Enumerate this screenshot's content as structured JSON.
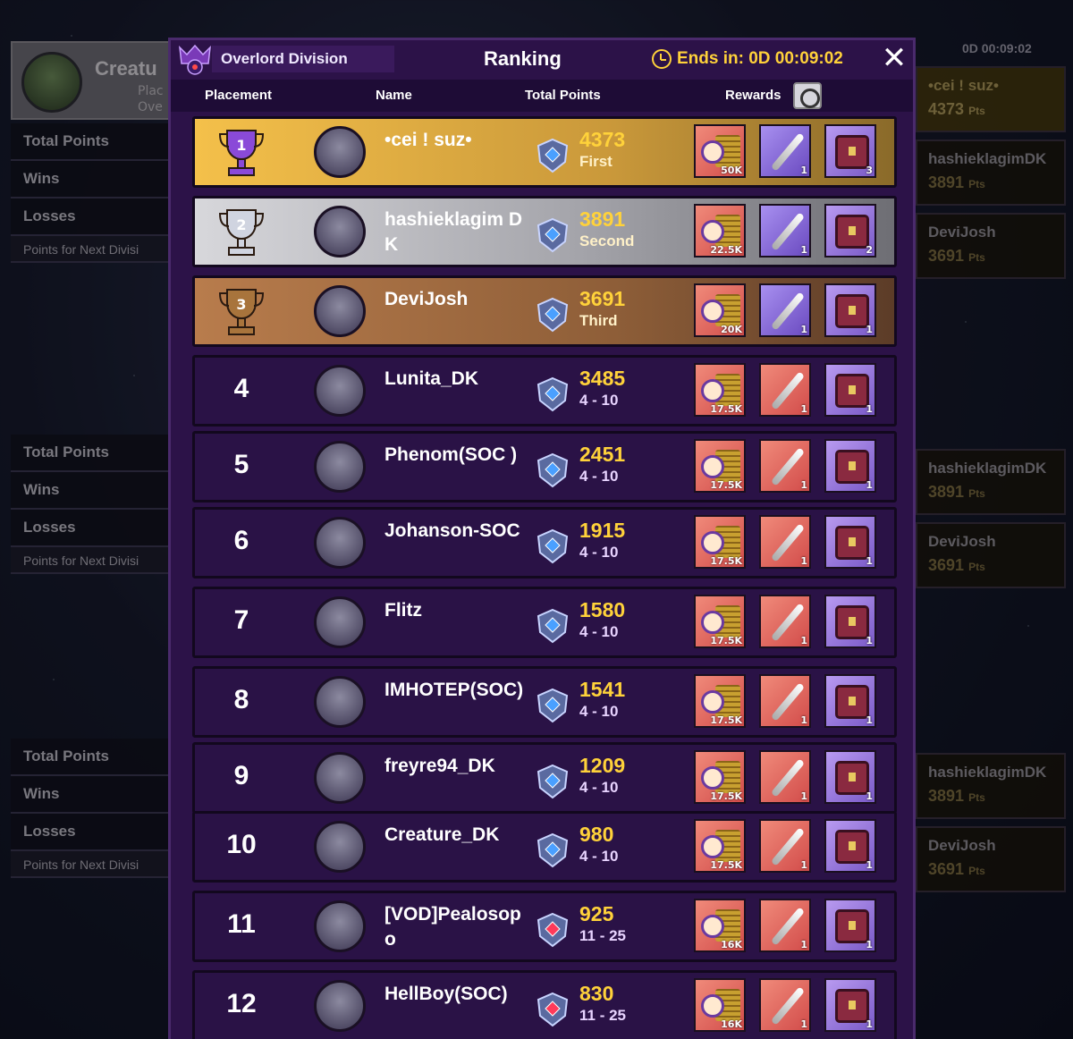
{
  "background": {
    "profile_name": "Creatu",
    "profile_sub1": "Plac",
    "profile_sub2": "Ove",
    "stat_groups": [
      [
        "Total Points",
        "Wins",
        "Losses",
        "Points for Next Divisi"
      ],
      [
        "Total Points",
        "Wins",
        "Losses",
        "Points for Next Divisi"
      ],
      [
        "Total Points",
        "Wins",
        "Losses",
        "Points for Next Divisi"
      ]
    ],
    "timer": "0D 00:09:02",
    "right_cards": [
      {
        "name": "•cei ! suz•",
        "pts": "4373",
        "unit": "Pts"
      },
      {
        "name": "hashieklagimDK",
        "pts": "3891",
        "unit": "Pts"
      },
      {
        "name": "DeviJosh",
        "pts": "3691",
        "unit": "Pts"
      },
      {
        "name": "hashieklagimDK",
        "pts": "3891",
        "unit": "Pts"
      },
      {
        "name": "DeviJosh",
        "pts": "3691",
        "unit": "Pts"
      },
      {
        "name": "hashieklagimDK",
        "pts": "3891",
        "unit": "Pts"
      },
      {
        "name": "DeviJosh",
        "pts": "3691",
        "unit": "Pts"
      }
    ]
  },
  "panel": {
    "division": "Overlord Division",
    "title": "Ranking",
    "timer": "Ends in: 0D 00:09:02",
    "close": "✕"
  },
  "headers": {
    "placement": "Placement",
    "name": "Name",
    "total_points": "Total Points",
    "rewards": "Rewards"
  },
  "rows": [
    {
      "place": "",
      "name": "•cei ! suz•",
      "points": "4373",
      "sub": "First",
      "coin": "50K",
      "sword": "1",
      "chest": "3"
    },
    {
      "place": "",
      "name": "hashieklagim DK",
      "points": "3891",
      "sub": "Second",
      "coin": "22.5K",
      "sword": "1",
      "chest": "2"
    },
    {
      "place": "",
      "name": "DeviJosh",
      "points": "3691",
      "sub": "Third",
      "coin": "20K",
      "sword": "1",
      "chest": "1"
    },
    {
      "place": "4",
      "name": "Lunita_DK",
      "points": "3485",
      "sub": "4 - 10",
      "coin": "17.5K",
      "sword": "1",
      "chest": "1"
    },
    {
      "place": "5",
      "name": "Phenom(SOC )",
      "points": "2451",
      "sub": "4 - 10",
      "coin": "17.5K",
      "sword": "1",
      "chest": "1"
    },
    {
      "place": "6",
      "name": "Johanson-SOC",
      "points": "1915",
      "sub": "4 - 10",
      "coin": "17.5K",
      "sword": "1",
      "chest": "1"
    },
    {
      "place": "7",
      "name": "Flitz",
      "points": "1580",
      "sub": "4 - 10",
      "coin": "17.5K",
      "sword": "1",
      "chest": "1"
    },
    {
      "place": "8",
      "name": "IMHOTEP(SOC)",
      "points": "1541",
      "sub": "4 - 10",
      "coin": "17.5K",
      "sword": "1",
      "chest": "1"
    },
    {
      "place": "9",
      "name": "freyre94_DK",
      "points": "1209",
      "sub": "4 - 10",
      "coin": "17.5K",
      "sword": "1",
      "chest": "1"
    },
    {
      "place": "10",
      "name": "Creature_DK",
      "points": "980",
      "sub": "4 - 10",
      "coin": "17.5K",
      "sword": "1",
      "chest": "1"
    },
    {
      "place": "11",
      "name": "[VOD]Pealosopo",
      "points": "925",
      "sub": "11 - 25",
      "coin": "16K",
      "sword": "1",
      "chest": "1"
    },
    {
      "place": "12",
      "name": "HellBoy(SOC)",
      "points": "830",
      "sub": "11 - 25",
      "coin": "16K",
      "sword": "1",
      "chest": "1"
    }
  ],
  "colors": {
    "accent": "#ffd23a",
    "panel": "#2c1248",
    "row": "#2a1246"
  }
}
